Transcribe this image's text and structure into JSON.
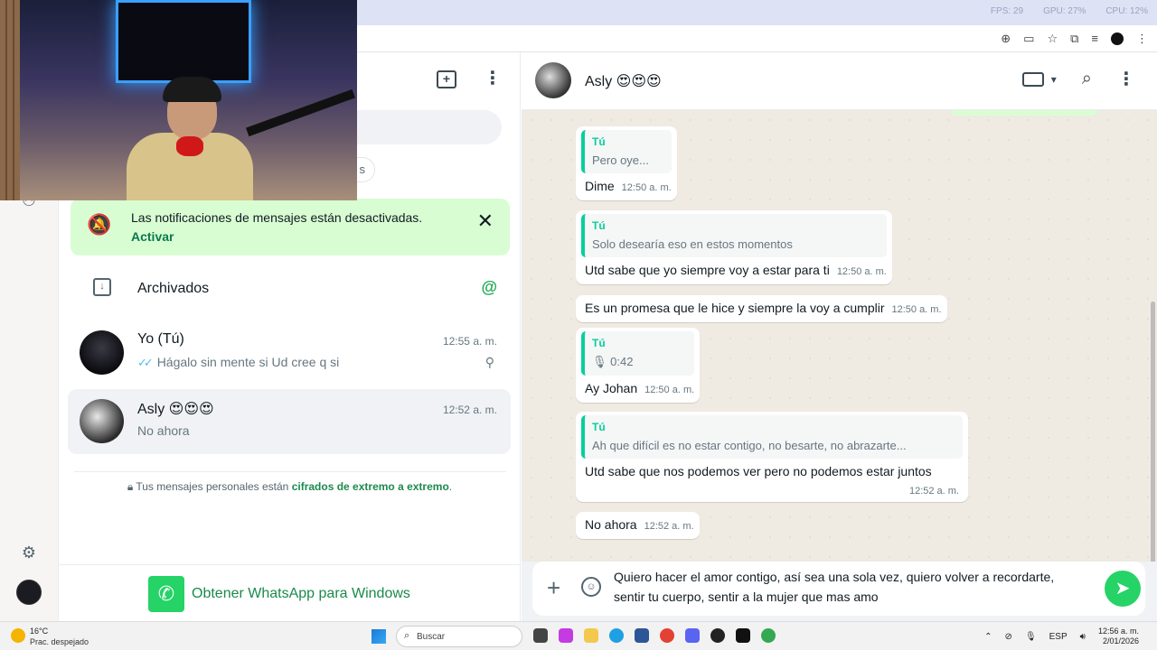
{
  "browser": {
    "stats": [
      "FPS: 29",
      "GPU: 27%",
      "CPU: 12%"
    ]
  },
  "sidebar": {
    "notification": {
      "message": "Las notificaciones de mensajes están desactivadas.",
      "action": "Activar"
    },
    "filter_label": "s",
    "archived_label": "Archivados",
    "chats": [
      {
        "name": "Yo (Tú)",
        "time": "12:55 a. m.",
        "preview": "Hágalo sin mente si Ud cree q si"
      },
      {
        "name": "Asly 😍😍😍",
        "time": "12:52 a. m.",
        "preview": "No ahora"
      }
    ],
    "encryption_prefix": "Tus mensajes personales están",
    "encryption_link": "cifrados de extremo a extremo",
    "encryption_suffix": ".",
    "get_app_label": "Obtener WhatsApp para Windows"
  },
  "conversation": {
    "contact_name": "Asly 😍😍😍",
    "messages": [
      {
        "quote_author": "Tú",
        "quote_text": "Pero oye...",
        "text": "Dime",
        "time": "12:50 a. m."
      },
      {
        "quote_author": "Tú",
        "quote_text": "Solo desearía eso en estos momentos",
        "text": "Utd sabe que yo siempre voy a estar para ti",
        "time": "12:50 a. m."
      },
      {
        "text": "Es un promesa que le hice y siempre la voy a cumplir",
        "time": "12:50 a. m."
      },
      {
        "quote_author": "Tú",
        "quote_text": "0:42",
        "text": "Ay Johan",
        "time": "12:50 a. m."
      },
      {
        "quote_author": "Tú",
        "quote_text": "Ah que difícil es no estar contigo, no besarte, no abrazarte...",
        "text": "Utd sabe que nos podemos ver pero no podemos estar juntos",
        "time": "12:52 a. m."
      },
      {
        "text": "No ahora",
        "time": "12:52 a. m."
      }
    ],
    "composer_text": "Quiero hacer el amor contigo, así sea una sola vez, quiero volver a recordarte, sentir tu cuerpo, sentir a la mujer que mas amo"
  },
  "taskbar": {
    "weather_temp": "16°C",
    "weather_desc": "Prac. despejado",
    "search_label": "Buscar",
    "language": "ESP",
    "time": "12:56 a. m.",
    "date": "2/01/2026"
  },
  "colors": {
    "accent": "#25d366",
    "notif_bg": "#d9fdd3",
    "quote_bar": "#06cf9c",
    "chat_bg": "#efeae2"
  }
}
